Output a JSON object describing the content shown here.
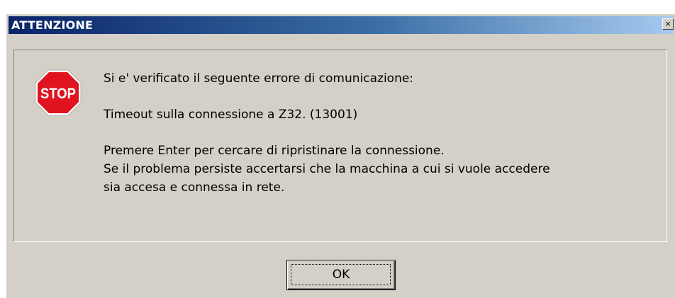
{
  "dialog": {
    "title": "ATTENZIONE",
    "close_glyph": "×",
    "icon": "stop-icon",
    "icon_text": "STOP",
    "message": {
      "line1": "Si e' verificato il seguente errore di comunicazione:",
      "line2": "Timeout sulla connessione a Z32. (13001)",
      "line3": "Premere Enter per cercare di ripristinare la connessione.",
      "line4": "Se il problema persiste accertarsi che la macchina a cui si vuole accedere",
      "line5": "sia accesa e connessa in rete."
    },
    "ok_label": "OK"
  },
  "colors": {
    "titlebar_start": "#0a246a",
    "titlebar_end": "#a6caf0",
    "face": "#d4d0c8",
    "stop_red": "#e0141e"
  }
}
